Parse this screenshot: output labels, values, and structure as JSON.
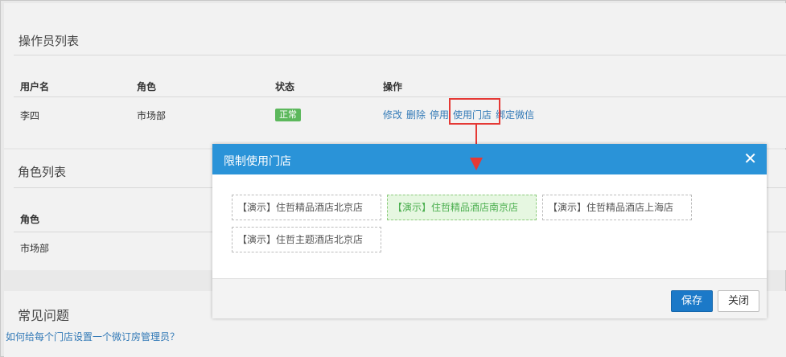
{
  "operator_list": {
    "title": "操作员列表",
    "columns": [
      "用户名",
      "角色",
      "状态",
      "操作"
    ],
    "rows": [
      {
        "username": "李四",
        "role": "市场部",
        "status": "正常",
        "actions": [
          "修改",
          "删除",
          "停用",
          "使用门店",
          "绑定微信"
        ]
      }
    ]
  },
  "role_list": {
    "title": "角色列表",
    "columns": [
      "角色"
    ],
    "rows": [
      {
        "role": "市场部"
      }
    ]
  },
  "faq": {
    "title": "常见问题",
    "link": "如何给每个门店设置一个微订房管理员？"
  },
  "modal": {
    "title": "限制使用门店",
    "close_glyph": "✕",
    "stores": [
      {
        "label": "【演示】住哲精品酒店北京店",
        "selected": false
      },
      {
        "label": "【演示】住哲精品酒店南京店",
        "selected": true
      },
      {
        "label": "【演示】住哲精品酒店上海店",
        "selected": false
      },
      {
        "label": "【演示】住哲主题酒店北京店",
        "selected": false
      }
    ],
    "save_label": "保存",
    "close_label": "关闭"
  },
  "colors": {
    "modal_header": "#2a93d8",
    "save_button": "#1b79c8",
    "status_badge": "#5cb85c",
    "highlight": "#e53935",
    "link": "#337ab7"
  }
}
